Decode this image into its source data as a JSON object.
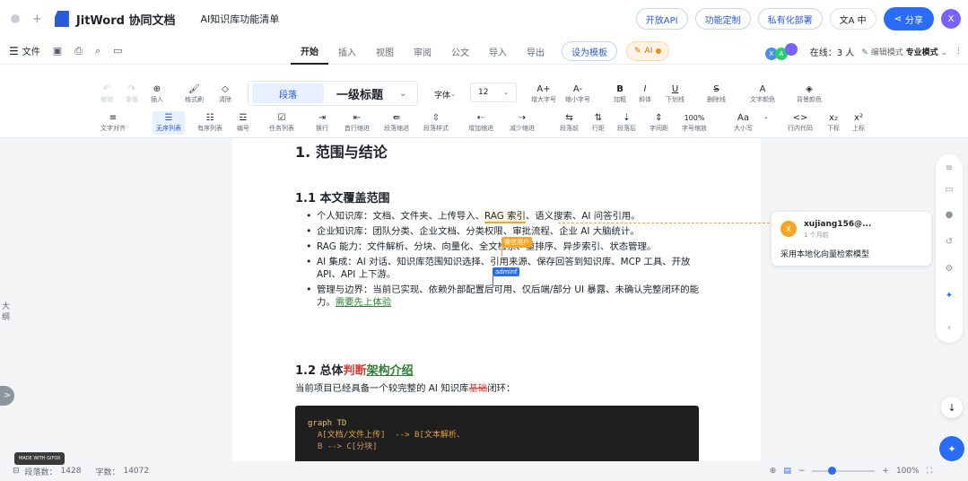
{
  "header": {
    "brand": "JitWord 协同文档",
    "doc_title": "AI知识库功能清单",
    "open_api": "开放API",
    "custom": "功能定制",
    "private": "私有化部署",
    "lang": "中",
    "share": "分享",
    "avatar": "X"
  },
  "menubar": {
    "file": "文件",
    "tabs": [
      "开始",
      "插入",
      "视图",
      "审阅",
      "公文",
      "导入",
      "导出"
    ],
    "template": "设为模板",
    "ai": "AI",
    "online": "在线：3 人",
    "edit_mode_label": "编辑模式",
    "edit_mode_value": "专业模式",
    "avatars": [
      {
        "letter": "X",
        "color": "#4a90e2"
      },
      {
        "letter": "A",
        "color": "#2ecc71"
      },
      {
        "letter": "",
        "color": "#7b61ff"
      }
    ]
  },
  "toolbar": {
    "row1": [
      {
        "glyph": "↶",
        "label": "撤销",
        "dim": true
      },
      {
        "glyph": "↷",
        "label": "重做",
        "dim": true
      },
      {
        "glyph": "⊕",
        "label": "插入"
      },
      {
        "glyph": "🖌",
        "label": "格式刷"
      },
      {
        "glyph": "◇",
        "label": "清除"
      }
    ],
    "style_para": "段落",
    "style_h1": "一级标题",
    "font": "字体",
    "font_size": "12",
    "row1b": [
      {
        "glyph": "A+",
        "label": "增大字号"
      },
      {
        "glyph": "A-",
        "label": "缩小字号"
      },
      {
        "glyph": "B",
        "label": "加粗"
      },
      {
        "glyph": "I",
        "label": "斜体"
      },
      {
        "glyph": "U",
        "label": "下划线"
      },
      {
        "glyph": "S",
        "label": "删除线"
      },
      {
        "glyph": "A",
        "label": "文字颜色"
      },
      {
        "glyph": "◈",
        "label": "背景颜色"
      }
    ],
    "row2": [
      {
        "glyph": "≡",
        "label": "文字对齐"
      },
      {
        "glyph": "☰",
        "label": "无序列表",
        "selected": true
      },
      {
        "glyph": "☷",
        "label": "有序列表"
      },
      {
        "glyph": "☲",
        "label": "编号"
      },
      {
        "glyph": "☑",
        "label": "任务列表"
      },
      {
        "glyph": "⇥",
        "label": "换行"
      },
      {
        "glyph": "⇤",
        "label": "首行缩进"
      },
      {
        "glyph": "⇚",
        "label": "段落缩进"
      },
      {
        "glyph": "⇳",
        "label": "段落样式"
      },
      {
        "glyph": "⇠",
        "label": "增加缩进"
      },
      {
        "glyph": "⇢",
        "label": "减少缩进"
      },
      {
        "glyph": "⇆",
        "label": "段落前"
      },
      {
        "glyph": "⇅",
        "label": "行距"
      },
      {
        "glyph": "⇣",
        "label": "段落后"
      },
      {
        "glyph": "⇕",
        "label": "字间距"
      },
      {
        "glyph": "100%",
        "label": "字号缩放"
      },
      {
        "glyph": "Aa",
        "label": "大小写"
      },
      {
        "glyph": "-",
        "label": ""
      },
      {
        "glyph": "<>",
        "label": "行内代码"
      },
      {
        "glyph": "x₂",
        "label": "下标"
      },
      {
        "glyph": "x²",
        "label": "上标"
      }
    ]
  },
  "left_panel": {
    "label": "大纲",
    "toggle": ">"
  },
  "document": {
    "h1": "1. 范围与结论",
    "h2_1": "1.1 本文覆盖范围",
    "bullets": [
      {
        "pre": "个人知识库：文档、文件夹、上传导入、",
        "hl": "RAG 索引",
        "post": "、语义搜索、AI 问答引用。"
      },
      {
        "pre": "企业知识库：团队分类、企业文档、分类权限、审批流程、企业 AI 大脑统计。",
        "hl": "",
        "post": ""
      },
      {
        "pre": "RAG 能力：文件解析、分块、向量化、全文检索、重排序、异步索引、状态管理。",
        "hl": "",
        "post": ""
      },
      {
        "pre": "AI 集成：AI 对话、知识库范围知识选择、引用来源、保存回答到知识库、MCP 工具、开放 API、API 上下游。",
        "hl": "",
        "post": ""
      },
      {
        "pre": "管理与边界：当前已实现、依赖外部配置后可用、仅后端/部分 UI 暴露、未确认完整闭环的能力。",
        "hl": "",
        "post": "",
        "link": "需要先上体验"
      }
    ],
    "collab_user1": "微信用户",
    "collab_user2": "adminf",
    "h2_2_pre": "1.2 总体",
    "h2_2_red": "判断",
    "h2_2_green": "架构介绍",
    "para_pre": "当前项目已经具备一个较完整的 AI 知识库",
    "para_strike": "基础",
    "para_post": "闭环：",
    "code_lines": [
      "graph TD",
      "  A[文档/文件上传]  --> B[文本解析、",
      "  B --> C[分块]"
    ]
  },
  "comment": {
    "avatar": "X",
    "user": "xujiang156@...",
    "time": "1 个月前",
    "text": "采用本地化向量检索模型"
  },
  "statusbar": {
    "made_with": "MADE WITH GIFOX",
    "para_count_label": "段落数：",
    "para_count": "1428",
    "word_count_label": "字数：",
    "word_count": "14072",
    "zoom": "100%"
  }
}
